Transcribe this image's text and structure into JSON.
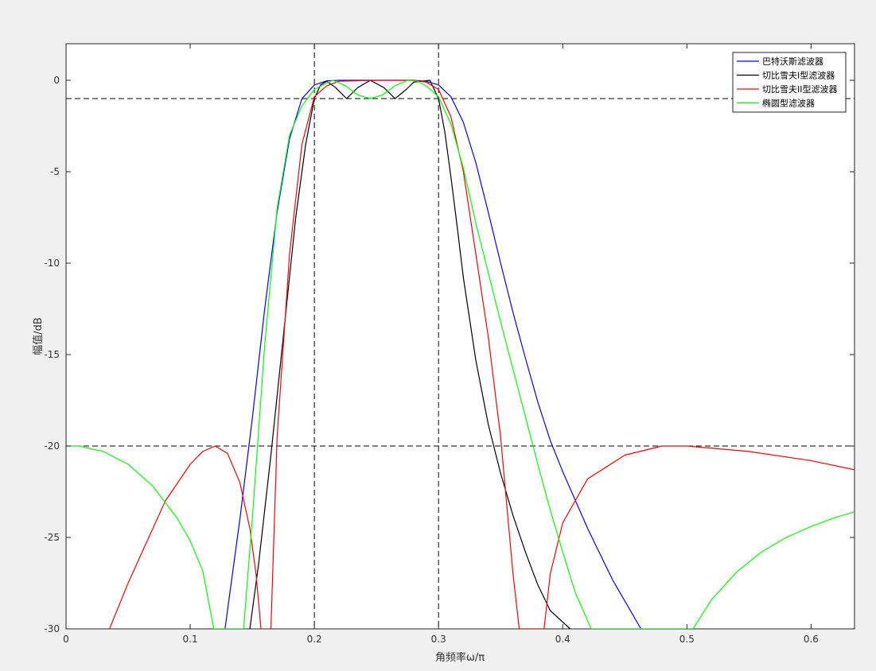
{
  "chart_data": {
    "type": "line",
    "title": "",
    "xlabel": "角频率ω/π",
    "ylabel": "幅值/dB",
    "xlim": [
      0,
      0.635
    ],
    "ylim": [
      -30,
      2
    ],
    "xticks": [
      0,
      0.1,
      0.2,
      0.3,
      0.4,
      0.5,
      0.6
    ],
    "xtick_labels": [
      "0",
      "0.1",
      "0.2",
      "0.3",
      "0.4",
      "0.5",
      "0.6"
    ],
    "yticks": [
      0,
      -5,
      -10,
      -15,
      -20,
      -25,
      -30
    ],
    "ytick_labels": [
      "0",
      "-5",
      "-10",
      "-15",
      "-20",
      "-25",
      "-30"
    ],
    "grid": false,
    "legend_position": "top-right",
    "reference_lines": {
      "vertical_x": [
        0.2,
        0.3
      ],
      "horizontal_y": [
        -1,
        -20
      ]
    },
    "series": [
      {
        "name": "巴特沃斯滤波器",
        "color": "#0000ff",
        "x": [
          0.128,
          0.14,
          0.15,
          0.16,
          0.17,
          0.18,
          0.19,
          0.2,
          0.21,
          0.22,
          0.25,
          0.28,
          0.29,
          0.3,
          0.31,
          0.32,
          0.33,
          0.34,
          0.35,
          0.36,
          0.37,
          0.38,
          0.39,
          0.4,
          0.42,
          0.44,
          0.463
        ],
        "y": [
          -30,
          -24,
          -18.5,
          -12.5,
          -7.2,
          -3.2,
          -1,
          -0.25,
          -0.03,
          0,
          0,
          0,
          -0.05,
          -0.25,
          -0.9,
          -2.3,
          -4.5,
          -7.2,
          -10,
          -12.7,
          -15.2,
          -17.6,
          -19.7,
          -21.4,
          -24.5,
          -27.3,
          -30
        ]
      },
      {
        "name": "切比雪夫I型滤波器",
        "color": "#000000",
        "x": [
          0.148,
          0.155,
          0.165,
          0.175,
          0.185,
          0.193,
          0.2,
          0.205,
          0.21,
          0.217,
          0.226,
          0.235,
          0.245,
          0.256,
          0.265,
          0.274,
          0.28,
          0.287,
          0.293,
          0.3,
          0.305,
          0.31,
          0.315,
          0.32,
          0.33,
          0.34,
          0.35,
          0.36,
          0.37,
          0.38,
          0.39,
          0.406
        ],
        "y": [
          -30,
          -26.5,
          -20.5,
          -14,
          -7.5,
          -3.5,
          -1,
          -0.25,
          -0.05,
          -0.4,
          -1,
          -0.4,
          0,
          -0.4,
          -1,
          -0.5,
          -0.1,
          -0.05,
          0,
          -1,
          -2.8,
          -5.3,
          -8,
          -10.8,
          -15.3,
          -18.8,
          -21.5,
          -23.8,
          -25.8,
          -27.6,
          -29,
          -30
        ]
      },
      {
        "name": "切比雪夫II型滤波器",
        "color": "#ff0000",
        "x": [
          0.035,
          0.05,
          0.06,
          0.07,
          0.08,
          0.09,
          0.1,
          0.11,
          0.12,
          0.13,
          0.14,
          0.148,
          0.153,
          0.157,
          0.165,
          0.17,
          0.18,
          0.19,
          0.2,
          0.21,
          0.22,
          0.25,
          0.28,
          0.29,
          0.3,
          0.31,
          0.32,
          0.33,
          0.34,
          0.35,
          0.36,
          0.365,
          0.385,
          0.39,
          0.4,
          0.42,
          0.45,
          0.48,
          0.5,
          0.55,
          0.6,
          0.635
        ],
        "y": [
          -30,
          -27.5,
          -26,
          -24.5,
          -23,
          -22,
          -21,
          -20.3,
          -20,
          -20.4,
          -22,
          -24.5,
          -27,
          -30,
          -30,
          -19.5,
          -9.5,
          -3.5,
          -0.9,
          -0.3,
          -0.05,
          0,
          0,
          -0.1,
          -0.5,
          -2,
          -5,
          -9.5,
          -14,
          -19.5,
          -27,
          -30,
          -30,
          -27,
          -24.2,
          -21.8,
          -20.5,
          -20,
          -20,
          -20.3,
          -20.8,
          -21.3
        ]
      },
      {
        "name": "椭圆型滤波器",
        "color": "#00ff00",
        "x": [
          0,
          0.01,
          0.03,
          0.05,
          0.07,
          0.09,
          0.1,
          0.11,
          0.119,
          0.143,
          0.15,
          0.16,
          0.17,
          0.18,
          0.19,
          0.2,
          0.21,
          0.215,
          0.225,
          0.235,
          0.245,
          0.255,
          0.265,
          0.275,
          0.283,
          0.29,
          0.3,
          0.31,
          0.32,
          0.33,
          0.34,
          0.35,
          0.36,
          0.37,
          0.38,
          0.39,
          0.4,
          0.41,
          0.423,
          0.505,
          0.52,
          0.54,
          0.56,
          0.58,
          0.6,
          0.62,
          0.635
        ],
        "y": [
          -20,
          -20,
          -20.3,
          -21,
          -22.2,
          -24,
          -25.2,
          -26.8,
          -30,
          -30,
          -24,
          -14.5,
          -7,
          -3,
          -1.4,
          -0.5,
          -0.15,
          0,
          -0.3,
          -0.8,
          -1,
          -0.8,
          -0.3,
          0,
          -0.05,
          -0.3,
          -0.9,
          -2.4,
          -4.8,
          -7.8,
          -10.5,
          -13.2,
          -15.8,
          -18.4,
          -21,
          -23.5,
          -25.8,
          -28,
          -30,
          -30,
          -28.4,
          -26.9,
          -25.8,
          -25,
          -24.4,
          -23.9,
          -23.6
        ]
      }
    ]
  }
}
